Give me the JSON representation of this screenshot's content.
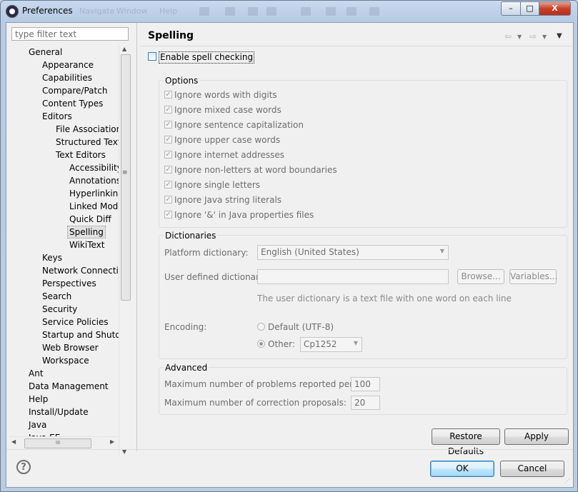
{
  "window": {
    "title": "Preferences",
    "ghost_menu": [
      "Navigate",
      "Window",
      "Help"
    ],
    "controls": [
      "–",
      "□",
      "X"
    ]
  },
  "sidebar": {
    "filter_placeholder": "type filter text",
    "tree": [
      {
        "label": "General",
        "level": 1
      },
      {
        "label": "Appearance",
        "level": 2
      },
      {
        "label": "Capabilities",
        "level": 2
      },
      {
        "label": "Compare/Patch",
        "level": 2
      },
      {
        "label": "Content Types",
        "level": 2
      },
      {
        "label": "Editors",
        "level": 2
      },
      {
        "label": "File Associations",
        "level": 3
      },
      {
        "label": "Structured Text E",
        "level": 3
      },
      {
        "label": "Text Editors",
        "level": 3
      },
      {
        "label": "Accessibility",
        "level": 4
      },
      {
        "label": "Annotations",
        "level": 4
      },
      {
        "label": "Hyperlinking",
        "level": 4
      },
      {
        "label": "Linked Mode",
        "level": 4
      },
      {
        "label": "Quick Diff",
        "level": 4
      },
      {
        "label": "Spelling",
        "level": 4,
        "selected": true
      },
      {
        "label": "WikiText",
        "level": 4
      },
      {
        "label": "Keys",
        "level": 2
      },
      {
        "label": "Network Connection",
        "level": 2
      },
      {
        "label": "Perspectives",
        "level": 2
      },
      {
        "label": "Search",
        "level": 2
      },
      {
        "label": "Security",
        "level": 2
      },
      {
        "label": "Service Policies",
        "level": 2
      },
      {
        "label": "Startup and Shutdo",
        "level": 2
      },
      {
        "label": "Web Browser",
        "level": 2
      },
      {
        "label": "Workspace",
        "level": 2
      },
      {
        "label": "Ant",
        "level": 1
      },
      {
        "label": "Data Management",
        "level": 1
      },
      {
        "label": "Help",
        "level": 1
      },
      {
        "label": "Install/Update",
        "level": 1
      },
      {
        "label": "Java",
        "level": 1
      },
      {
        "label": "Java EE",
        "level": 1
      }
    ]
  },
  "page": {
    "title": "Spelling",
    "enable_label": "Enable spell checking",
    "enable_checked": false,
    "options": {
      "title": "Options",
      "items": [
        "Ignore words with digits",
        "Ignore mixed case words",
        "Ignore sentence capitalization",
        "Ignore upper case words",
        "Ignore internet addresses",
        "Ignore non-letters at word boundaries",
        "Ignore single letters",
        "Ignore Java string literals",
        "Ignore '&' in Java properties files"
      ]
    },
    "dictionaries": {
      "title": "Dictionaries",
      "platform_label": "Platform dictionary:",
      "platform_value": "English (United States)",
      "user_label": "User defined dictionary:",
      "user_value": "",
      "browse": "Browse...",
      "variables": "Variables...",
      "hint": "The user dictionary is a text file with one word on each line",
      "encoding_label": "Encoding:",
      "default_label": "Default (UTF-8)",
      "other_label": "Other:",
      "other_value": "Cp1252"
    },
    "advanced": {
      "title": "Advanced",
      "max_problems_label": "Maximum number of problems reported per file:",
      "max_problems_value": "100",
      "max_proposals_label": "Maximum number of correction proposals:",
      "max_proposals_value": "20"
    },
    "restore_defaults": "Restore Defaults",
    "apply": "Apply"
  },
  "footer": {
    "help": "?",
    "ok": "OK",
    "cancel": "Cancel"
  },
  "colors": {
    "accent": "#3c7fb1",
    "disabled_text": "#6d6d6d"
  }
}
